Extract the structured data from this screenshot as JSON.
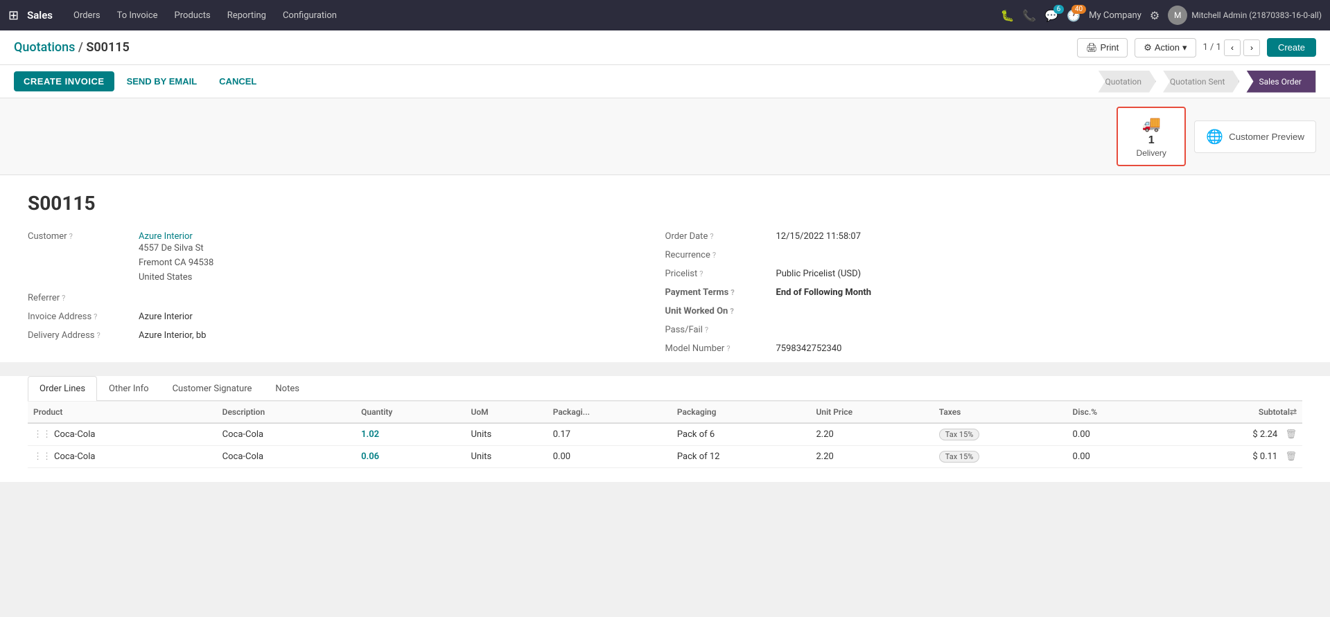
{
  "topnav": {
    "brand": "Sales",
    "items": [
      "Orders",
      "To Invoice",
      "Products",
      "Reporting",
      "Configuration"
    ],
    "badge_chat": "6",
    "badge_activity": "40",
    "company": "My Company",
    "user": "Mitchell Admin (21870383-16-0-all)"
  },
  "breadcrumb": {
    "parent": "Quotations",
    "separator": "/",
    "current": "S00115"
  },
  "toolbar": {
    "print_label": "Print",
    "action_label": "Action",
    "pager": "1 / 1",
    "create_label": "Create"
  },
  "action_bar": {
    "create_invoice_label": "CREATE INVOICE",
    "send_email_label": "SEND BY EMAIL",
    "cancel_label": "CANCEL"
  },
  "status_steps": [
    {
      "label": "Quotation",
      "state": "done"
    },
    {
      "label": "Quotation Sent",
      "state": "done"
    },
    {
      "label": "Sales Order",
      "state": "active"
    }
  ],
  "smart_buttons": [
    {
      "icon": "🚚",
      "count": "1",
      "label": "Delivery",
      "highlighted": true
    }
  ],
  "customer_preview": {
    "label": "Customer Preview"
  },
  "form": {
    "order_id": "S00115",
    "customer_label": "Customer",
    "customer_name": "Azure Interior",
    "customer_address_line1": "4557 De Silva St",
    "customer_address_line2": "Fremont CA 94538",
    "customer_address_line3": "United States",
    "referrer_label": "Referrer",
    "referrer_value": "",
    "invoice_address_label": "Invoice Address",
    "invoice_address_value": "Azure Interior",
    "delivery_address_label": "Delivery Address",
    "delivery_address_value": "Azure Interior, bb",
    "order_date_label": "Order Date",
    "order_date_value": "12/15/2022 11:58:07",
    "recurrence_label": "Recurrence",
    "recurrence_value": "",
    "pricelist_label": "Pricelist",
    "pricelist_value": "Public Pricelist (USD)",
    "payment_terms_label": "Payment Terms",
    "payment_terms_value": "End of Following Month",
    "unit_worked_on_label": "Unit Worked On",
    "unit_worked_on_value": "",
    "pass_fail_label": "Pass/Fail",
    "pass_fail_value": "",
    "model_number_label": "Model Number",
    "model_number_value": "7598342752340"
  },
  "tabs": [
    {
      "label": "Order Lines",
      "active": true
    },
    {
      "label": "Other Info",
      "active": false
    },
    {
      "label": "Customer Signature",
      "active": false
    },
    {
      "label": "Notes",
      "active": false
    }
  ],
  "table": {
    "columns": [
      "Product",
      "Description",
      "Quantity",
      "UoM",
      "Packagi...",
      "Packaging",
      "Unit Price",
      "Taxes",
      "Disc.%",
      "Subtotal"
    ],
    "rows": [
      {
        "product": "Coca-Cola",
        "description": "Coca-Cola",
        "quantity": "1.02",
        "uom": "Units",
        "packaging_qty": "0.17",
        "packaging": "Pack of 6",
        "unit_price": "2.20",
        "taxes": "Tax 15%",
        "disc": "0.00",
        "subtotal": "$ 2.24"
      },
      {
        "product": "Coca-Cola",
        "description": "Coca-Cola",
        "quantity": "0.06",
        "uom": "Units",
        "packaging_qty": "0.00",
        "packaging": "Pack of 12",
        "unit_price": "2.20",
        "taxes": "Tax 15%",
        "disc": "0.00",
        "subtotal": "$ 0.11"
      }
    ]
  }
}
